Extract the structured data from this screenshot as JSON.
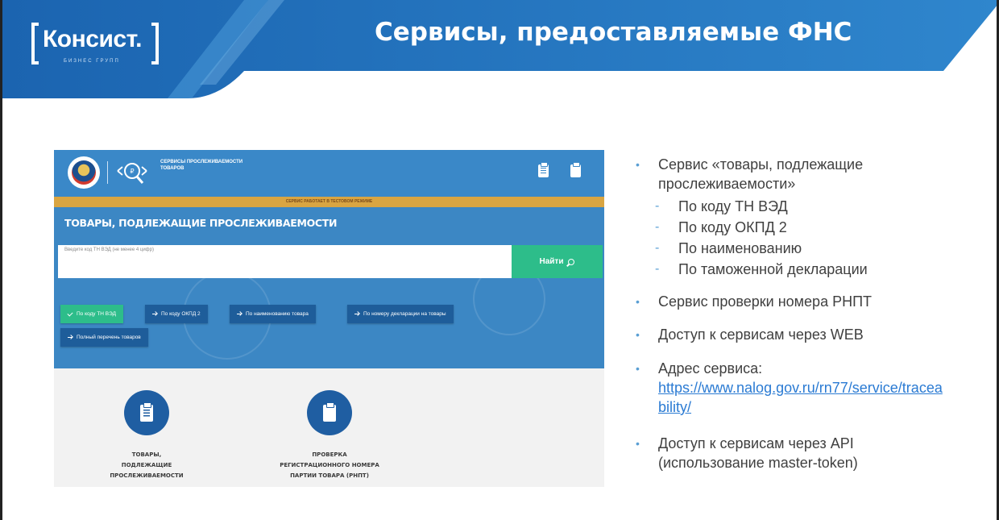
{
  "header": {
    "logo_text": "Консист.",
    "logo_subtext": "БИЗНЕС ГРУПП",
    "title": "Сервисы, предоставляемые ФНС"
  },
  "screenshot": {
    "service_name": "СЕРВИСЫ ПРОСЛЕЖИВАЕМОСТИ ТОВАРОВ",
    "test_mode_banner": "СЕРВИС РАБОТАЕТ В ТЕСТОВОМ РЕЖИМЕ",
    "heading": "ТОВАРЫ, ПОДЛЕЖАЩИЕ ПРОСЛЕЖИВАЕМОСТИ",
    "search_placeholder": "Введите код ТН ВЭД (не менее 4 цифр)",
    "search_button": "Найти",
    "filters": [
      {
        "label": "По коду ТН ВЭД",
        "active": true
      },
      {
        "label": "По коду ОКПД 2",
        "active": false
      },
      {
        "label": "По наименованию товара",
        "active": false
      },
      {
        "label": "По номеру декларации на товары",
        "active": false
      },
      {
        "label": "Полный перечень товаров",
        "active": false
      }
    ],
    "cards": [
      {
        "caption": "ТОВАРЫ, ПОДЛЕЖАЩИЕ ПРОСЛЕЖИВАЕМОСТИ",
        "icon": "clipboard-list-icon"
      },
      {
        "caption": "ПРОВЕРКА РЕГИСТРАЦИОННОГО НОМЕРА ПАРТИИ ТОВАРА (РНПТ)",
        "icon": "clipboard-icon"
      }
    ],
    "cards_lines": [
      [
        "ТОВАРЫ,",
        "ПОДЛЕЖАЩИЕ",
        "ПРОСЛЕЖИВАЕМОСТИ"
      ],
      [
        "ПРОВЕРКА",
        "РЕГИСТРАЦИОННОГО НОМЕРА",
        "ПАРТИИ ТОВАРА (РНПТ)"
      ]
    ]
  },
  "bullets": {
    "items": [
      "Сервис «товары, подлежащие прослеживаемости»",
      "Сервис проверки номера РНПТ",
      "Доступ к сервисам через WEB",
      "Адрес сервиса:",
      "Доступ к сервисам через API (использование master-token)"
    ],
    "sub_items": [
      "По коду ТН ВЭД",
      "По коду ОКПД 2",
      "По наименованию",
      "По таможенной декларации"
    ],
    "service_url": "https://www.nalog.gov.ru/rn77/service/traceability/"
  },
  "colors": {
    "brand_blue": "#1f5ea2",
    "accent_green": "#2dbd8a",
    "test_bar": "#d9a542",
    "bullet": "#5a9fd4"
  }
}
